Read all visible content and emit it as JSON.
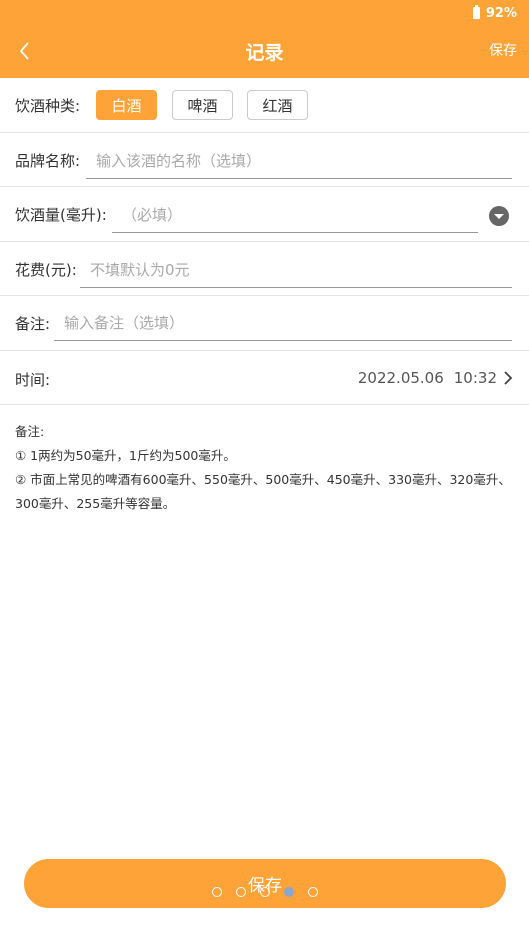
{
  "status": {
    "battery": "92%"
  },
  "header": {
    "title": "记录",
    "save_label": "保存"
  },
  "drink_type": {
    "label": "饮酒种类:",
    "options": [
      {
        "label": "白酒",
        "selected": true
      },
      {
        "label": "啤酒",
        "selected": false
      },
      {
        "label": "红酒",
        "selected": false
      }
    ]
  },
  "brand": {
    "label": "品牌名称:",
    "placeholder": "输入该酒的名称（选填）"
  },
  "amount": {
    "label": "饮酒量(毫升):",
    "placeholder": "（必填）"
  },
  "cost": {
    "label": "花费(元):",
    "placeholder": "不填默认为0元"
  },
  "remark": {
    "label": "备注:",
    "placeholder": "输入备注（选填）"
  },
  "time": {
    "label": "时间:",
    "date": "2022.05.06",
    "clock": "10:32"
  },
  "notes": {
    "title": "备注:",
    "line1": "① 1两约为50毫升，1斤约为500毫升。",
    "line2": "② 市面上常见的啤酒有600毫升、550毫升、500毫升、450毫升、330毫升、320毫升、300毫升、255毫升等容量。"
  },
  "bottom": {
    "save_label": "保存"
  },
  "colors": {
    "accent": "#fda337",
    "dot_active": "#8aa6cc"
  }
}
